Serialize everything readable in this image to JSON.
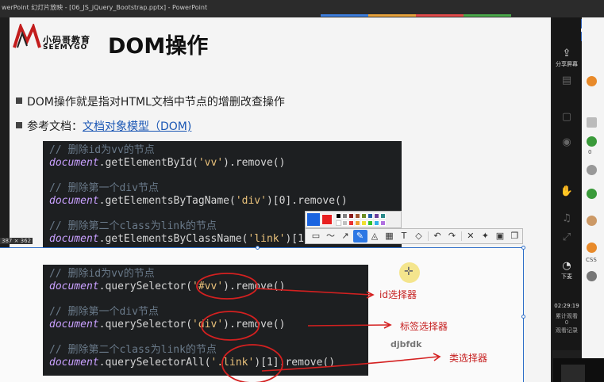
{
  "window": {
    "title": "werPoint 幻灯片放映 - [06_JS_jQuery_Bootstrap.pptx] - PowerPoint"
  },
  "slide": {
    "logo_cn": "小码哥教育",
    "logo_en": "SEEMYGO",
    "title": "DOM操作",
    "bullet1": "DOM操作就是指对HTML文档中节点的增删改查操作",
    "bullet2_prefix": "参考文档：",
    "bullet2_link": "文档对象模型（DOM)"
  },
  "code_top": {
    "c1": "// 删除id为vv的节点",
    "l1_obj": "document",
    "l1_a": ".getElementById(",
    "l1_str": "'vv'",
    "l1_b": ").remove()",
    "c2": "// 删除第一个div节点",
    "l2_obj": "document",
    "l2_a": ".getElementsByTagName(",
    "l2_str": "'div'",
    "l2_b": ")[0].remove()",
    "c3": "// 删除第二个class为link的节点",
    "l3_obj": "document",
    "l3_a": ".getElementsByClassName(",
    "l3_str": "'link'",
    "l3_b": ")[1].remove()"
  },
  "code_bottom": {
    "c1": "// 删除id为vv的节点",
    "l1_obj": "document",
    "l1_a": ".querySelector(",
    "l1_str": "'#vv'",
    "l1_b": ").remove()",
    "c2": "// 删除第一个div节点",
    "l2_obj": "document",
    "l2_a": ".querySelector(",
    "l2_str": "'div'",
    "l2_b": ").remove()",
    "c3": "// 删除第二个class为link的节点",
    "l3_obj": "document",
    "l3_a": ".querySelectorAll(",
    "l3_str": "'.link'",
    "l3_b": ")[1].remove()"
  },
  "annotations": {
    "id_selector": "id选择器",
    "tag_selector": "标签选择器",
    "class_selector": "类选择器",
    "watermark": "djbfdk"
  },
  "screenshot_tool": {
    "size_label": "387 × 362",
    "current_color": "#e82020",
    "tools": [
      "rect",
      "curve",
      "arrow",
      "pen",
      "marker",
      "mosaic",
      "text",
      "eraser",
      "undo",
      "redo",
      "close",
      "pin",
      "save",
      "copy"
    ]
  },
  "side_panel": {
    "share_label": "分享屏幕",
    "hand_label": "举手",
    "time": "02:29:19",
    "total_label": "累计观看",
    "count": "0",
    "watch_label": "观看记录",
    "down_label": "下麦",
    "css_label": "CSS"
  }
}
